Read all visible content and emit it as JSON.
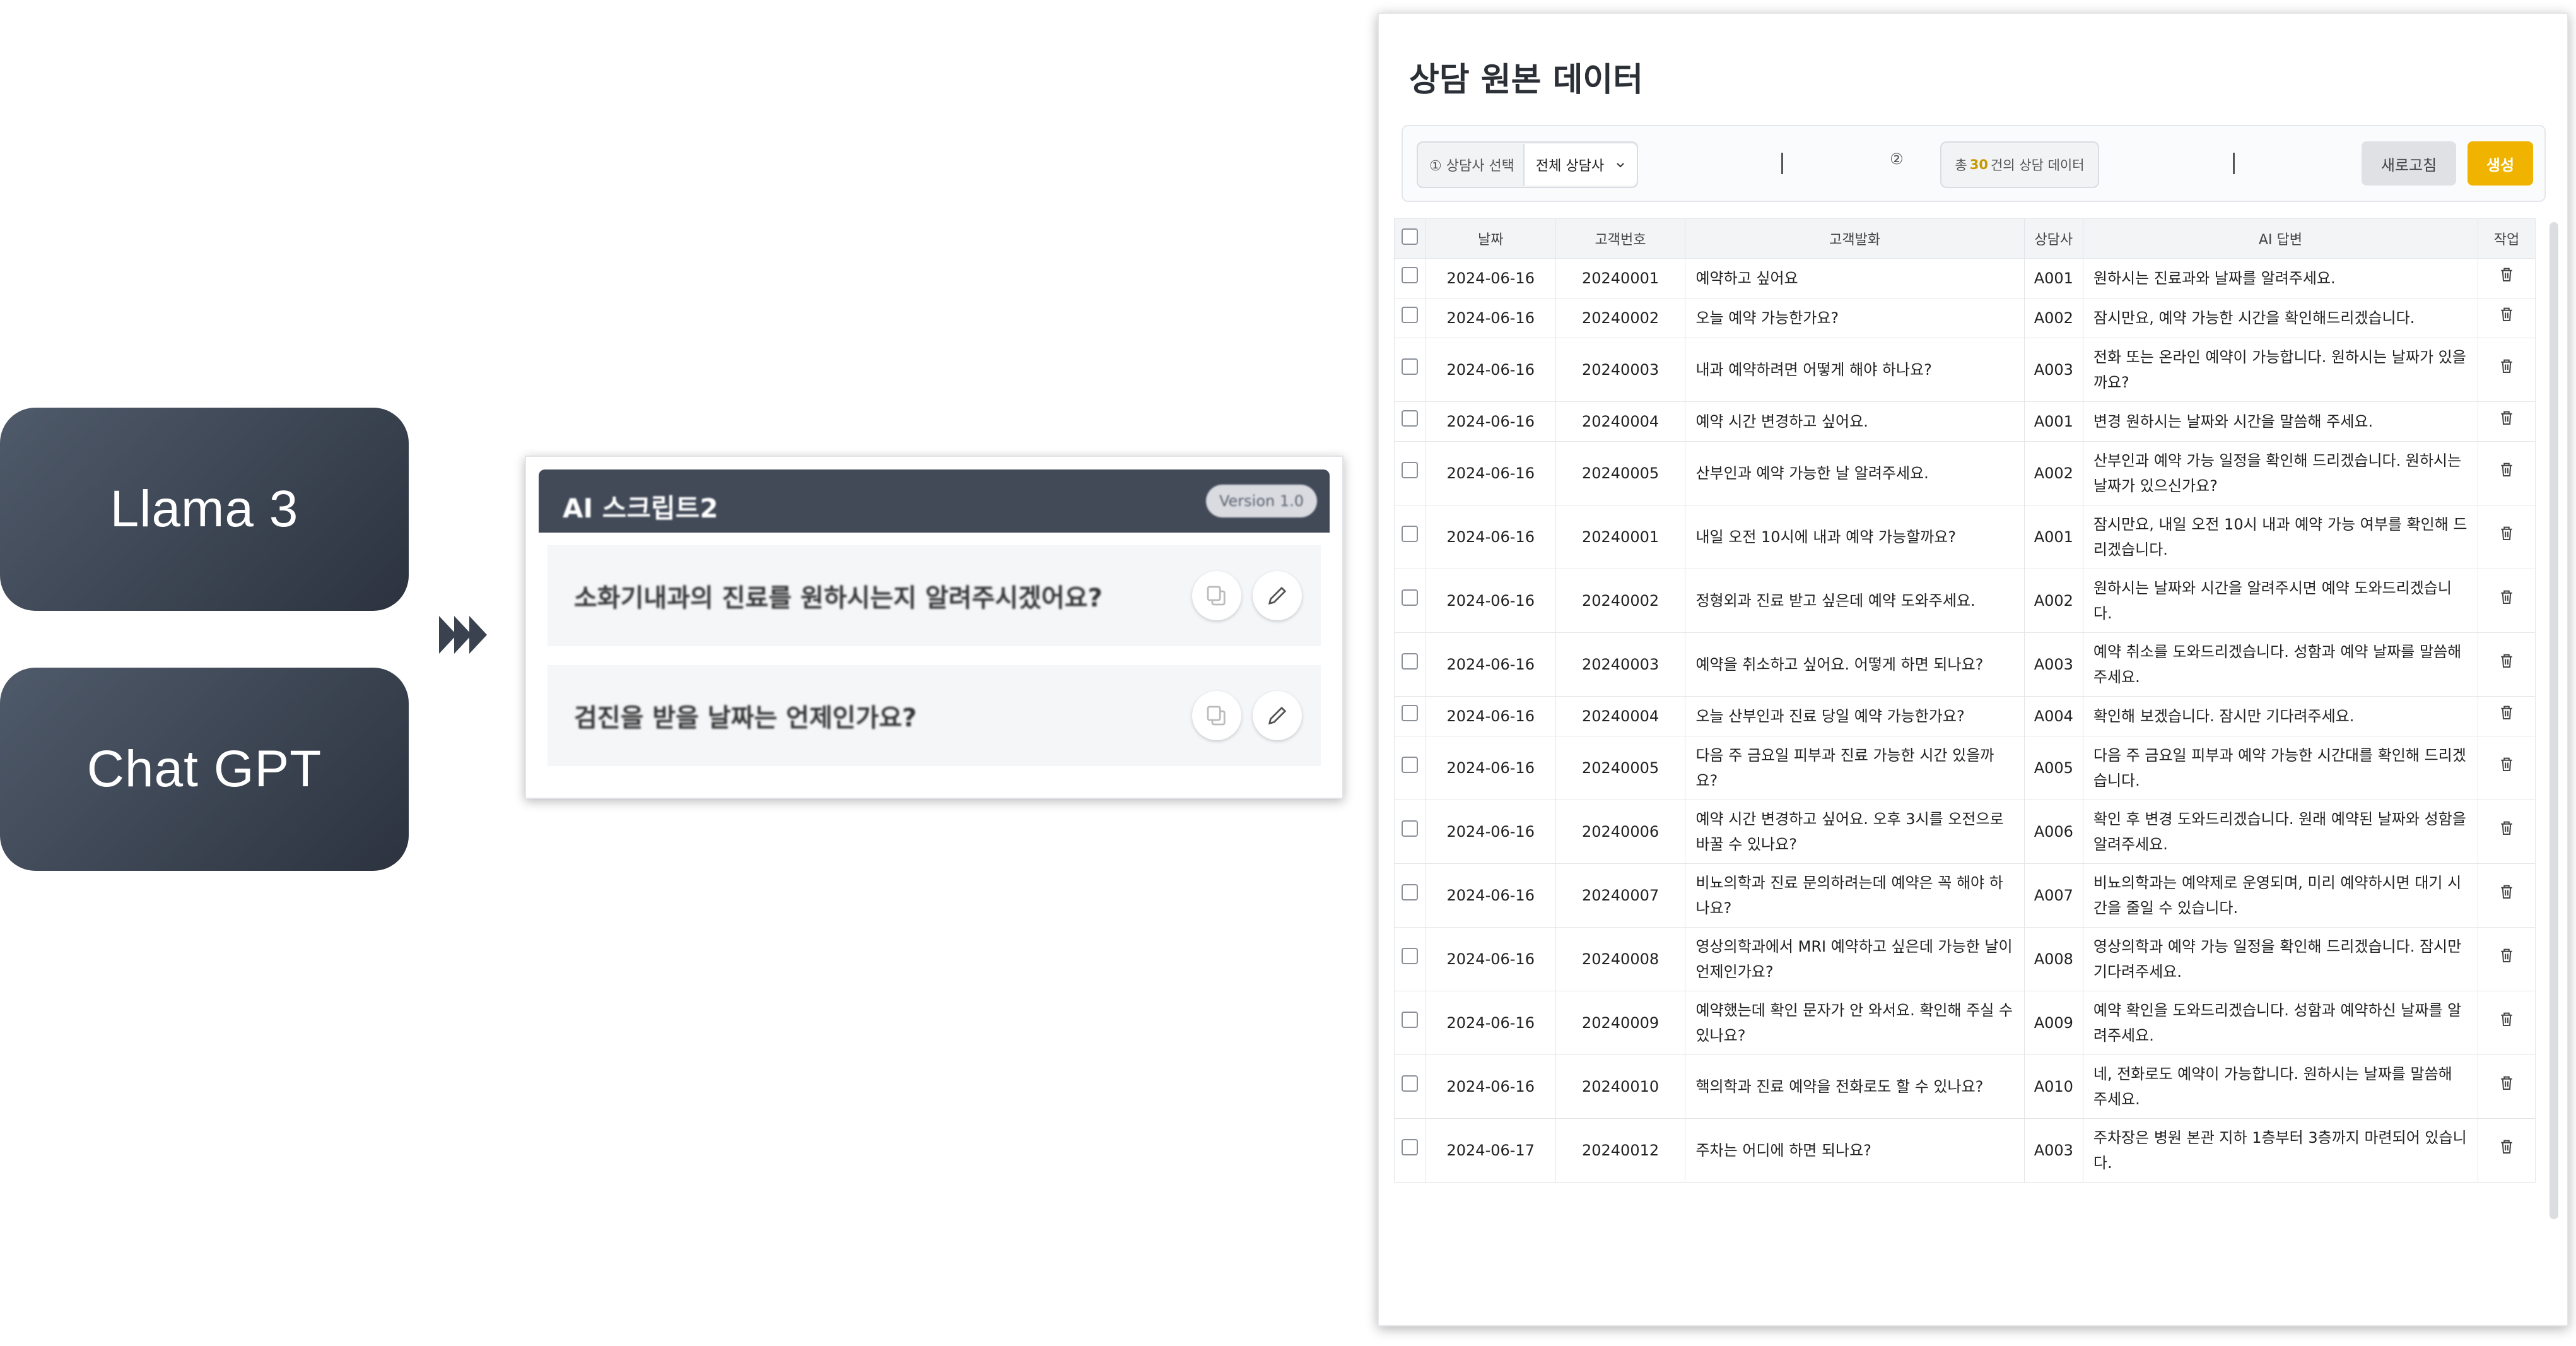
{
  "models": [
    {
      "label": "Llama 3"
    },
    {
      "label": "Chat GPT"
    }
  ],
  "script_card": {
    "title": "AI 스크립트2",
    "version": "Version 1.0",
    "questions": [
      "소화기내과의 진료를 원하시는지 알려주시겠어요?",
      "검진을 받을 날짜는 언제인가요?"
    ]
  },
  "panel": {
    "title": "상담 원본 데이터",
    "toolbar": {
      "counselor_label": "① 상담사 선택",
      "counselor_select": "전체 상담사",
      "step2": "②",
      "count_prefix": "총",
      "count_value": "30",
      "count_suffix": "건의 상담 데이터",
      "refresh": "새로고침",
      "generate": "생성"
    },
    "columns": [
      "날짜",
      "고객번호",
      "고객발화",
      "상담사",
      "AI 답변",
      "작업"
    ],
    "rows": [
      {
        "date": "2024-06-16",
        "customer": "20240001",
        "utterance": "예약하고 싶어요",
        "agent": "A001",
        "answer": "원하시는 진료과와 날짜를 알려주세요."
      },
      {
        "date": "2024-06-16",
        "customer": "20240002",
        "utterance": "오늘 예약 가능한가요?",
        "agent": "A002",
        "answer": "잠시만요, 예약 가능한 시간을 확인해드리겠습니다."
      },
      {
        "date": "2024-06-16",
        "customer": "20240003",
        "utterance": "내과 예약하려면 어떻게 해야 하나요?",
        "agent": "A003",
        "answer": "전화 또는 온라인 예약이 가능합니다. 원하시는 날짜가 있을까요?"
      },
      {
        "date": "2024-06-16",
        "customer": "20240004",
        "utterance": "예약 시간 변경하고 싶어요.",
        "agent": "A001",
        "answer": "변경 원하시는 날짜와 시간을 말씀해 주세요."
      },
      {
        "date": "2024-06-16",
        "customer": "20240005",
        "utterance": "산부인과 예약 가능한 날 알려주세요.",
        "agent": "A002",
        "answer": "산부인과 예약 가능 일정을 확인해 드리겠습니다. 원하시는 날짜가 있으신가요?"
      },
      {
        "date": "2024-06-16",
        "customer": "20240001",
        "utterance": "내일 오전 10시에 내과 예약 가능할까요?",
        "agent": "A001",
        "answer": "잠시만요, 내일 오전 10시 내과 예약 가능 여부를 확인해 드리겠습니다."
      },
      {
        "date": "2024-06-16",
        "customer": "20240002",
        "utterance": "정형외과 진료 받고 싶은데 예약 도와주세요.",
        "agent": "A002",
        "answer": "원하시는 날짜와 시간을 알려주시면 예약 도와드리겠습니다."
      },
      {
        "date": "2024-06-16",
        "customer": "20240003",
        "utterance": "예약을 취소하고 싶어요. 어떻게 하면 되나요?",
        "agent": "A003",
        "answer": "예약 취소를 도와드리겠습니다. 성함과 예약 날짜를 말씀해 주세요."
      },
      {
        "date": "2024-06-16",
        "customer": "20240004",
        "utterance": "오늘 산부인과 진료 당일 예약 가능한가요?",
        "agent": "A004",
        "answer": "확인해 보겠습니다. 잠시만 기다려주세요."
      },
      {
        "date": "2024-06-16",
        "customer": "20240005",
        "utterance": "다음 주 금요일 피부과 진료 가능한 시간 있을까요?",
        "agent": "A005",
        "answer": "다음 주 금요일 피부과 예약 가능한 시간대를 확인해 드리겠습니다."
      },
      {
        "date": "2024-06-16",
        "customer": "20240006",
        "utterance": "예약 시간 변경하고 싶어요. 오후 3시를 오전으로 바꿀 수 있나요?",
        "agent": "A006",
        "answer": "확인 후 변경 도와드리겠습니다. 원래 예약된 날짜와 성함을 알려주세요."
      },
      {
        "date": "2024-06-16",
        "customer": "20240007",
        "utterance": "비뇨의학과 진료 문의하려는데 예약은 꼭 해야 하나요?",
        "agent": "A007",
        "answer": "비뇨의학과는 예약제로 운영되며, 미리 예약하시면 대기 시간을 줄일 수 있습니다."
      },
      {
        "date": "2024-06-16",
        "customer": "20240008",
        "utterance": "영상의학과에서 MRI 예약하고 싶은데 가능한 날이 언제인가요?",
        "agent": "A008",
        "answer": "영상의학과 예약 가능 일정을 확인해 드리겠습니다. 잠시만 기다려주세요."
      },
      {
        "date": "2024-06-16",
        "customer": "20240009",
        "utterance": "예약했는데 확인 문자가 안 와서요. 확인해 주실 수 있나요?",
        "agent": "A009",
        "answer": "예약 확인을 도와드리겠습니다. 성함과 예약하신 날짜를 알려주세요."
      },
      {
        "date": "2024-06-16",
        "customer": "20240010",
        "utterance": "핵의학과 진료 예약을 전화로도 할 수 있나요?",
        "agent": "A010",
        "answer": "네, 전화로도 예약이 가능합니다. 원하시는 날짜를 말씀해 주세요."
      },
      {
        "date": "2024-06-17",
        "customer": "20240012",
        "utterance": "주차는 어디에 하면 되나요?",
        "agent": "A003",
        "answer": "주차장은 병원 본관 지하 1층부터 3층까지 마련되어 있습니다."
      }
    ]
  },
  "colors": {
    "accent": "#f0b400",
    "header_dark": "#424a58",
    "model_bg": "#3a424f"
  }
}
